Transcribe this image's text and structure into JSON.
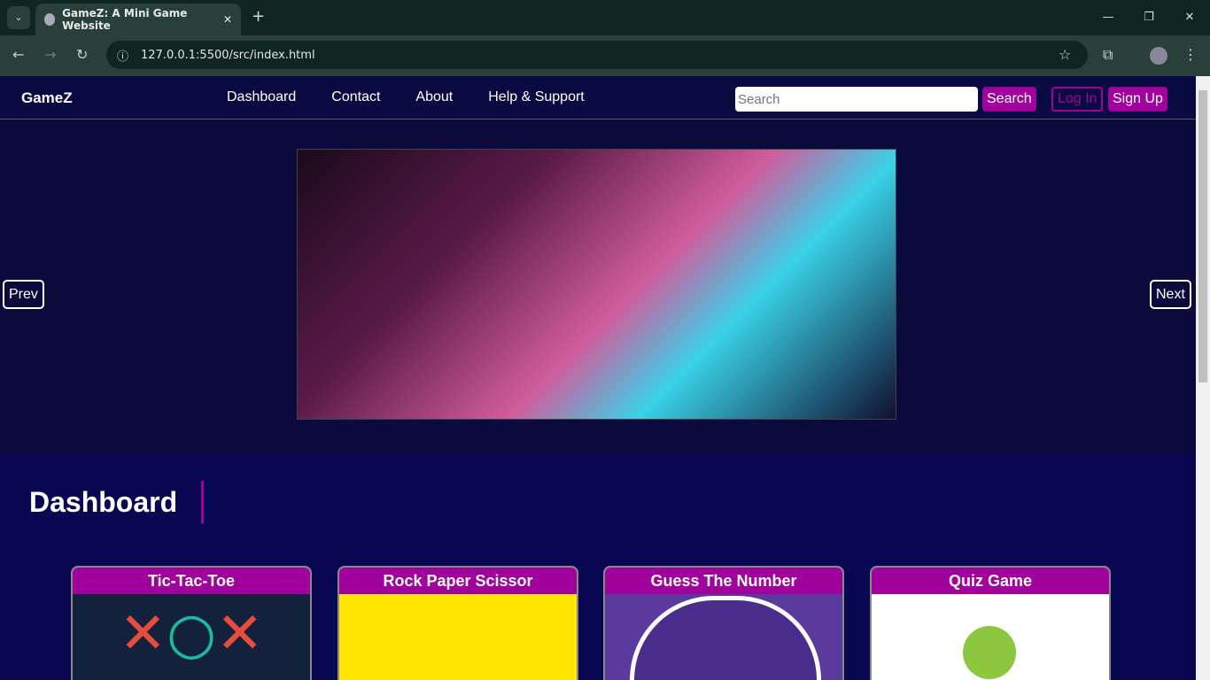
{
  "browser": {
    "tab_title": "GameZ: A Mini Game Website",
    "url": "127.0.0.1:5500/src/index.html"
  },
  "nav": {
    "logo": "GameZ",
    "links": [
      "Dashboard",
      "Contact",
      "About",
      "Help & Support"
    ],
    "search_placeholder": "Search",
    "search_button": "Search",
    "login": "Log In",
    "signup": "Sign Up"
  },
  "carousel": {
    "prev": "Prev",
    "next": "Next"
  },
  "dashboard": {
    "title": "Dashboard",
    "cards": [
      {
        "title": "Tic-Tac-Toe"
      },
      {
        "title": "Rock Paper Scissor"
      },
      {
        "title": "Guess The Number"
      },
      {
        "title": "Quiz Game"
      }
    ]
  }
}
